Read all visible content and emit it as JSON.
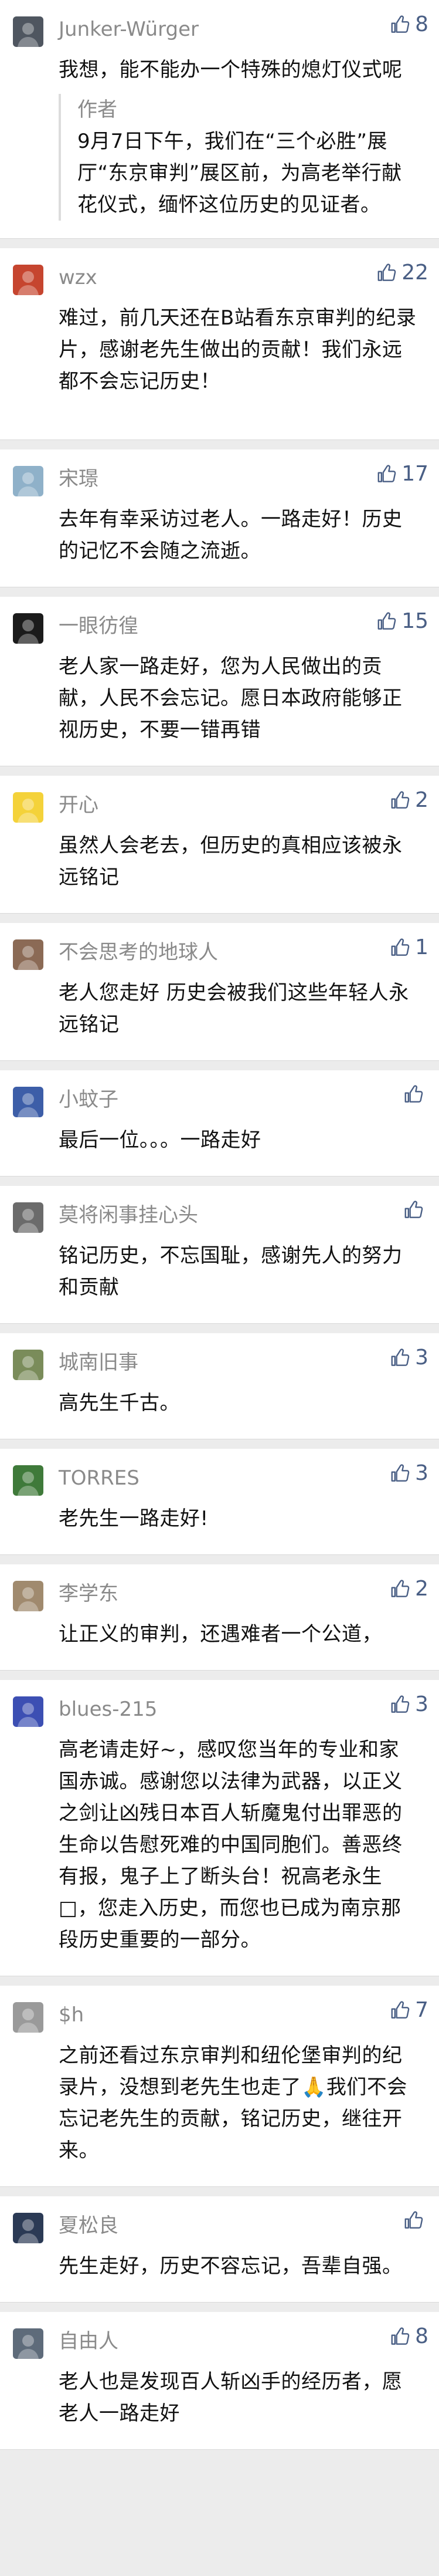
{
  "comments": [
    {
      "name": "Junker-Würger",
      "likes": "8",
      "avatar": "avatar-comic",
      "avatar_color": "#4f5660",
      "text": "我想，能不能办一个特殊的熄灯仪式呢",
      "reply": {
        "label": "作者",
        "text": "9月7日下午，我们在“三个必胜”展厅“东京审判”展区前，为高老举行献花仪式，缅怀这位历史的见证者。"
      }
    },
    {
      "name": "wzx",
      "likes": "22",
      "avatar": "avatar-cartoon",
      "avatar_color": "#c6452f",
      "text": "难过，前几天还在B站看东京审判的纪录片，感谢老先生做出的贡献！我们永远都不会忘记历史！"
    },
    {
      "name": "宋璟",
      "likes": "17",
      "avatar": "avatar-sky",
      "avatar_color": "#8fb1c9",
      "text": "去年有幸采访过老人。一路走好！历史的记忆不会随之流逝。"
    },
    {
      "name": "一眼彷徨",
      "likes": "15",
      "avatar": "avatar-circle",
      "avatar_color": "#1b1b1b",
      "text": "老人家一路走好，您为人民做出的贡献，人民不会忘记。愿日本政府能够正视历史，不要一错再错"
    },
    {
      "name": "开心",
      "likes": "2",
      "avatar": "avatar-pikachu",
      "avatar_color": "#f4d23a",
      "text": "虽然人会老去，但历史的真相应该被永远铭记"
    },
    {
      "name": "不会思考的地球人",
      "likes": "1",
      "avatar": "avatar-portrait",
      "avatar_color": "#8b6a55",
      "text": "老人您走好 历史会被我们这些年轻人永远铭记"
    },
    {
      "name": "小蚊子",
      "likes": "",
      "avatar": "avatar-mosquito",
      "avatar_color": "#3d5ea8",
      "text": "最后一位。。。一路走好"
    },
    {
      "name": "莫将闲事挂心头",
      "likes": "",
      "avatar": "avatar-portrait-2",
      "avatar_color": "#6b6b6b",
      "text": "铭记历史，不忘国耻，感谢先人的努力和贡献"
    },
    {
      "name": "城南旧事",
      "likes": "3",
      "avatar": "avatar-landscape",
      "avatar_color": "#7a8c5a",
      "text": "高先生千古。"
    },
    {
      "name": "TORRES",
      "likes": "3",
      "avatar": "avatar-stadium",
      "avatar_color": "#3f7a3a",
      "text": "老先生一路走好!"
    },
    {
      "name": "李学东",
      "likes": "2",
      "avatar": "avatar-group",
      "avatar_color": "#a08a6e",
      "text": "让正义的审判，还遇难者一个公道，"
    },
    {
      "name": "blues-215",
      "likes": "3",
      "avatar": "avatar-blue",
      "avatar_color": "#3c4fb3",
      "text": "高老请走好~，感叹您当年的专业和家国赤诚。感谢您以法律为武器，以正义之剑让凶残日本百人斩魔鬼付出罪恶的生命以告慰死难的中国同胞们。善恶终有报，鬼子上了断头台！祝高老永生□，您走入历史，而您也已成为南京那段历史重要的一部分。"
    },
    {
      "name": "$h",
      "likes": "7",
      "avatar": "avatar-mountain",
      "avatar_color": "#9a9a9a",
      "text": "之前还看过东京审判和纽伦堡审判的纪录片，没想到老先生也走了🙏我们不会忘记老先生的贡献，铭记历史，继往开来。"
    },
    {
      "name": "夏松良",
      "likes": "",
      "avatar": "avatar-dark",
      "avatar_color": "#2b3a55",
      "text": "先生走好，历史不容忘记，吾辈自强。"
    },
    {
      "name": "自由人",
      "likes": "8",
      "avatar": "avatar-street",
      "avatar_color": "#5e6b7a",
      "text": "老人也是发现百人斩凶手的经历者，愿老人一路走好"
    }
  ]
}
